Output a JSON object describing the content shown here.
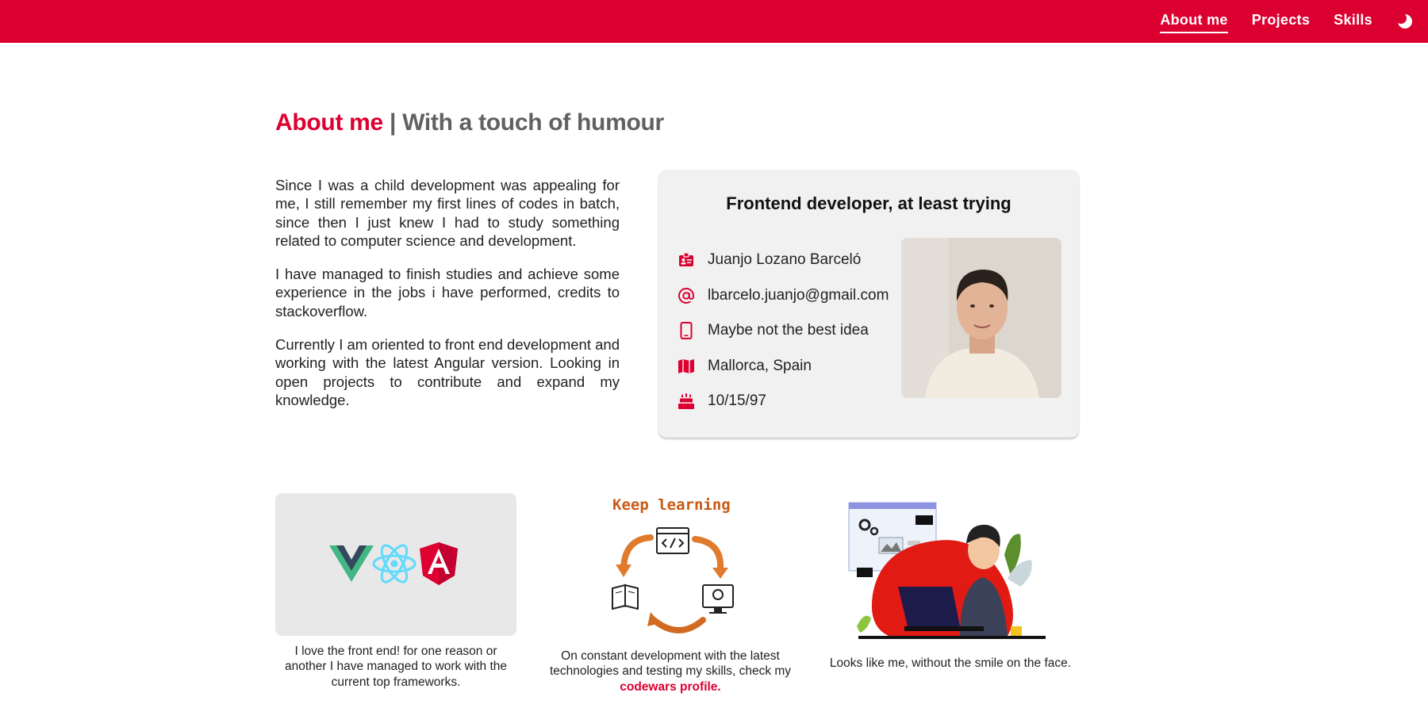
{
  "nav": {
    "items": [
      {
        "label": "About me",
        "active": true
      },
      {
        "label": "Projects",
        "active": false
      },
      {
        "label": "Skills",
        "active": false
      }
    ],
    "theme_icon": "moon-icon"
  },
  "heading": {
    "accent": "About me",
    "separator": "|",
    "rest": "With a touch of humour"
  },
  "intro": {
    "paragraphs": [
      "Since I was a child development was appealing for me, I still remember my first lines of codes in batch, since then I just knew I had to study something related to computer science and development.",
      "I have managed to finish studies and achieve some experience in the jobs i have performed, credits to stackoverflow.",
      "Currently I am oriented to front end development and working with the latest Angular version. Looking in open projects to contribute and expand my knowledge."
    ]
  },
  "card": {
    "title": "Frontend developer, at least trying",
    "items": [
      {
        "icon": "id-badge-icon",
        "text": "Juanjo Lozano Barceló"
      },
      {
        "icon": "at-sign-icon",
        "text": "lbarcelo.juanjo@gmail.com"
      },
      {
        "icon": "mobile-phone-icon",
        "text": "Maybe not the best idea"
      },
      {
        "icon": "map-icon",
        "text": "Mallorca, Spain"
      },
      {
        "icon": "birthday-cake-icon",
        "text": "10/15/97"
      }
    ]
  },
  "bottom": {
    "frameworks_caption": "I love the front end! for one reason or another I have managed to work with the current top frameworks.",
    "keep_learning_title": "Keep learning",
    "learning_caption": "On constant development with the latest technologies and testing my skills, check my",
    "learning_link": "codewars profile.",
    "illustration_caption": "Looks like me, without the smile on the face."
  },
  "colors": {
    "accent": "#dc0030",
    "heading_muted": "#616161",
    "card_bg": "#f1f1f1",
    "frameworks_bg": "#e8e8e8",
    "keep_learning": "#c95a14"
  }
}
